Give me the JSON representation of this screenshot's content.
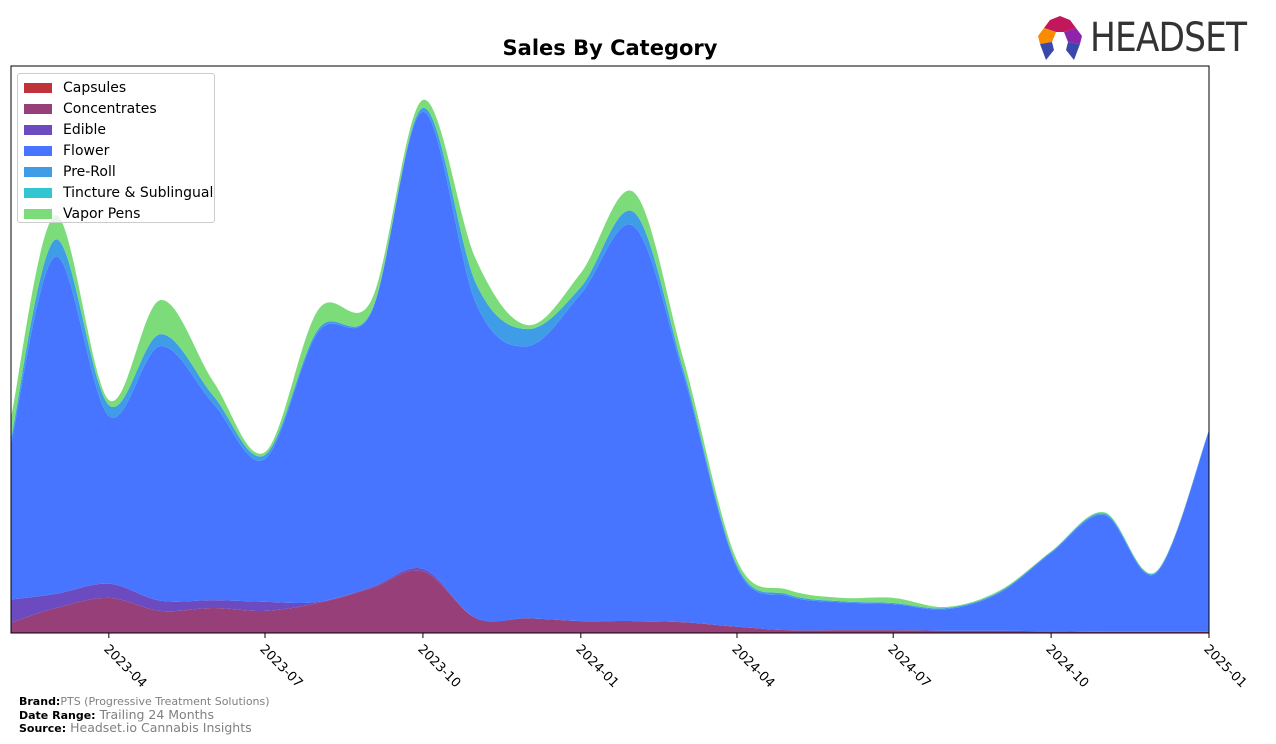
{
  "brand_logo": {
    "text": "HEADSET",
    "icon": "headset-hexagon-logo-icon",
    "colors": [
      "#c2185b",
      "#e53935",
      "#fb8c00",
      "#3949ab",
      "#8e24aa"
    ]
  },
  "footer": {
    "brand_label": "Brand:",
    "brand_value": "PTS (Progressive Treatment Solutions)",
    "date_label": "Date Range:",
    "date_value": "Trailing 24 Months",
    "source_label": "Source:",
    "source_value": "Headset.io Cannabis Insights"
  },
  "chart_data": {
    "type": "area",
    "stacked": true,
    "title": "Sales By Category",
    "xlabel": "",
    "ylabel": "",
    "y_axis_visible": false,
    "grid": false,
    "legend_position": "top-left",
    "x": [
      "2023-02",
      "2023-03",
      "2023-04",
      "2023-05",
      "2023-06",
      "2023-07",
      "2023-08",
      "2023-09",
      "2023-10",
      "2023-11",
      "2023-12",
      "2024-01",
      "2024-02",
      "2024-03",
      "2024-04",
      "2024-05",
      "2024-06",
      "2024-07",
      "2024-08",
      "2024-09",
      "2024-10",
      "2024-11",
      "2024-12",
      "2025-01"
    ],
    "xlim": [
      "2023-02-03",
      "2025-01-01"
    ],
    "x_ticks": [
      "2023-04",
      "2023-07",
      "2023-10",
      "2024-01",
      "2024-04",
      "2024-07",
      "2024-10",
      "2025-01"
    ],
    "ylim": [
      0,
      100
    ],
    "series": [
      {
        "name": "Capsules",
        "color": "#c0333a",
        "values": [
          0,
          0,
          0,
          0,
          0,
          0,
          0,
          0,
          0,
          0,
          0,
          0,
          0,
          0,
          0,
          0,
          0,
          0,
          0,
          0,
          0,
          0,
          0,
          0
        ]
      },
      {
        "name": "Concentrates",
        "color": "#963f78",
        "values": [
          1.8,
          4.4,
          6.2,
          3.9,
          4.4,
          3.9,
          5.3,
          7.9,
          10.9,
          2.6,
          2.6,
          2.1,
          2.1,
          1.9,
          1.1,
          0.5,
          0.5,
          0.5,
          0.4,
          0.4,
          0.3,
          0.2,
          0.2,
          0.2
        ]
      },
      {
        "name": "Edible",
        "color": "#6b4bbf",
        "values": [
          4.1,
          2.5,
          2.5,
          1.8,
          1.4,
          1.6,
          0.2,
          0.2,
          0.4,
          0,
          0,
          0,
          0,
          0,
          0,
          0,
          0,
          0,
          0,
          0,
          0,
          0,
          0,
          0
        ]
      },
      {
        "name": "Flower",
        "color": "#4775ff",
        "values": [
          27.5,
          59.5,
          29.6,
          44.9,
          34.6,
          25.2,
          47.6,
          48.5,
          80.6,
          55.5,
          48.0,
          57.7,
          69.6,
          43.4,
          10.4,
          6.0,
          4.9,
          4.6,
          3.8,
          6.7,
          13.8,
          20.6,
          10.3,
          35.4
        ]
      },
      {
        "name": "Pre-Roll",
        "color": "#3f9de8",
        "values": [
          0.9,
          3.0,
          1.9,
          2.1,
          1.4,
          0.7,
          0.5,
          0.2,
          0.7,
          3.5,
          3.0,
          1.2,
          2.5,
          0.9,
          0.4,
          0.3,
          0.2,
          0.2,
          0.2,
          0.2,
          0.2,
          0.3,
          0.2,
          0.2
        ]
      },
      {
        "name": "Tincture & Sublingual",
        "color": "#33c5d1",
        "values": [
          0,
          0,
          0,
          0,
          0,
          0,
          0,
          0,
          0,
          0,
          0,
          0,
          0,
          0,
          0,
          0,
          0,
          0,
          0,
          0,
          0,
          0,
          0,
          0
        ]
      },
      {
        "name": "Vapor Pens",
        "color": "#7ddc7a",
        "values": [
          3.7,
          4.3,
          0.9,
          6.0,
          2.5,
          0.5,
          3.4,
          1.9,
          1.4,
          4.2,
          0.7,
          2.5,
          3.5,
          1.9,
          0.9,
          0.8,
          0.6,
          0.9,
          0.2,
          0.2,
          0.1,
          0.2,
          0.1,
          0.0
        ]
      }
    ]
  }
}
